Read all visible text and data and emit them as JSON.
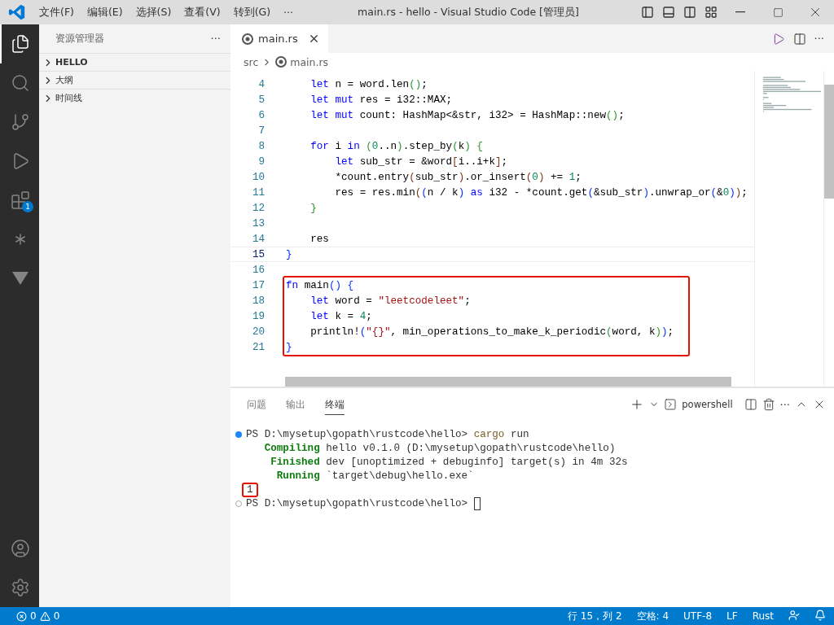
{
  "window": {
    "title": "main.rs - hello - Visual Studio Code [管理员]"
  },
  "menu": [
    "文件(F)",
    "编辑(E)",
    "选择(S)",
    "查看(V)",
    "转到(G)",
    "···"
  ],
  "activity_bar": {
    "items": [
      {
        "kind": "explorer",
        "selected": true
      },
      {
        "kind": "search",
        "selected": false
      },
      {
        "kind": "source-control",
        "selected": false
      },
      {
        "kind": "run",
        "selected": false
      },
      {
        "kind": "extensions",
        "selected": false,
        "badge": "1"
      },
      {
        "kind": "asterisk",
        "selected": false
      },
      {
        "kind": "triangle",
        "selected": false
      }
    ],
    "bottom": [
      {
        "kind": "account"
      },
      {
        "kind": "settings"
      }
    ]
  },
  "sidebar": {
    "title": "资源管理器",
    "more": "···",
    "sections": [
      {
        "label": "HELLO",
        "bold": true,
        "expanded": false
      },
      {
        "label": "大纲",
        "bold": false,
        "expanded": false
      },
      {
        "label": "时间线",
        "bold": false,
        "expanded": false
      }
    ]
  },
  "editor": {
    "tab": {
      "label": "main.rs",
      "more": "···"
    },
    "breadcrumbs": [
      "src",
      "main.rs"
    ],
    "lines": [
      {
        "number": "4",
        "tokens": [
          {
            "text": "    let",
            "kind": "kw"
          },
          {
            "text": " n = word.len",
            "kind": "plain"
          },
          {
            "text": "()",
            "kind": "b2"
          },
          {
            "text": ";",
            "kind": "plain"
          }
        ]
      },
      {
        "number": "5",
        "tokens": [
          {
            "text": "    let mut",
            "kind": "kw"
          },
          {
            "text": " res = i32::MAX;",
            "kind": "plain"
          }
        ]
      },
      {
        "number": "6",
        "tokens": [
          {
            "text": "    let mut",
            "kind": "kw"
          },
          {
            "text": " count: HashMap<&str, i32> = HashMap::new",
            "kind": "plain"
          },
          {
            "text": "()",
            "kind": "b2"
          },
          {
            "text": ";",
            "kind": "plain"
          }
        ]
      },
      {
        "number": "7"
      },
      {
        "number": "8",
        "tokens": [
          {
            "text": "    for",
            "kind": "kw"
          },
          {
            "text": " i ",
            "kind": "plain"
          },
          {
            "text": "in",
            "kind": "kw"
          },
          {
            "text": " (",
            "kind": "b2"
          },
          {
            "text": "0",
            "kind": "num"
          },
          {
            "text": "..n",
            "kind": "plain"
          },
          {
            "text": ")",
            "kind": "b2"
          },
          {
            "text": ".step_by",
            "kind": "plain"
          },
          {
            "text": "(",
            "kind": "b2"
          },
          {
            "text": "k",
            "kind": "plain"
          },
          {
            "text": ") {",
            "kind": "b2"
          }
        ]
      },
      {
        "number": "9",
        "tokens": [
          {
            "text": "        let",
            "kind": "kw"
          },
          {
            "text": " sub_str = &word",
            "kind": "plain"
          },
          {
            "text": "[",
            "kind": "b3"
          },
          {
            "text": "i..i+k",
            "kind": "plain"
          },
          {
            "text": "]",
            "kind": "b3"
          },
          {
            "text": ";",
            "kind": "plain"
          }
        ]
      },
      {
        "number": "10",
        "tokens": [
          {
            "text": "        *count.entry",
            "kind": "plain"
          },
          {
            "text": "(",
            "kind": "b3"
          },
          {
            "text": "sub_str",
            "kind": "plain"
          },
          {
            "text": ")",
            "kind": "b3"
          },
          {
            "text": ".or_insert",
            "kind": "plain"
          },
          {
            "text": "(",
            "kind": "b3"
          },
          {
            "text": "0",
            "kind": "num"
          },
          {
            "text": ")",
            "kind": "b3"
          },
          {
            "text": " += ",
            "kind": "plain"
          },
          {
            "text": "1",
            "kind": "num"
          },
          {
            "text": ";",
            "kind": "plain"
          }
        ]
      },
      {
        "number": "11",
        "tokens": [
          {
            "text": "        res = res.min",
            "kind": "plain"
          },
          {
            "text": "(",
            "kind": "b3"
          },
          {
            "text": "(",
            "kind": "b1"
          },
          {
            "text": "n / k",
            "kind": "plain"
          },
          {
            "text": ") ",
            "kind": "b1"
          },
          {
            "text": "as",
            "kind": "kw"
          },
          {
            "text": " i32 - *count.get",
            "kind": "plain"
          },
          {
            "text": "(",
            "kind": "b1"
          },
          {
            "text": "&sub_str",
            "kind": "plain"
          },
          {
            "text": ")",
            "kind": "b1"
          },
          {
            "text": ".unwrap_or",
            "kind": "plain"
          },
          {
            "text": "(",
            "kind": "b1"
          },
          {
            "text": "&",
            "kind": "plain"
          },
          {
            "text": "0",
            "kind": "num"
          },
          {
            "text": ")",
            "kind": "b1"
          },
          {
            "text": ")",
            "kind": "b3"
          },
          {
            "text": ";",
            "kind": "plain"
          }
        ]
      },
      {
        "number": "12",
        "tokens": [
          {
            "text": "    }",
            "kind": "b2"
          }
        ]
      },
      {
        "number": "13"
      },
      {
        "number": "14",
        "tokens": [
          {
            "text": "    res",
            "kind": "plain"
          }
        ]
      },
      {
        "number": "15",
        "current": true,
        "tokens": [
          {
            "text": "}",
            "kind": "b1"
          }
        ]
      },
      {
        "number": "16"
      },
      {
        "number": "17",
        "highlighted": true,
        "tokens": [
          {
            "text": "fn",
            "kind": "kw"
          },
          {
            "text": " main",
            "kind": "plain"
          },
          {
            "text": "() {",
            "kind": "b1"
          }
        ]
      },
      {
        "number": "18",
        "highlighted": true,
        "tokens": [
          {
            "text": "    let",
            "kind": "kw"
          },
          {
            "text": " word = ",
            "kind": "plain"
          },
          {
            "text": "\"leetcodeleet\"",
            "kind": "str"
          },
          {
            "text": ";",
            "kind": "plain"
          }
        ]
      },
      {
        "number": "19",
        "highlighted": true,
        "tokens": [
          {
            "text": "    let",
            "kind": "kw"
          },
          {
            "text": " k = ",
            "kind": "plain"
          },
          {
            "text": "4",
            "kind": "num"
          },
          {
            "text": ";",
            "kind": "plain"
          }
        ]
      },
      {
        "number": "20",
        "highlighted": true,
        "tokens": [
          {
            "text": "    println!",
            "kind": "plain"
          },
          {
            "text": "(",
            "kind": "b1"
          },
          {
            "text": "\"{}\"",
            "kind": "str"
          },
          {
            "text": ", min_operations_to_make_k_periodic",
            "kind": "plain"
          },
          {
            "text": "(",
            "kind": "b2"
          },
          {
            "text": "word, k",
            "kind": "plain"
          },
          {
            "text": ")",
            "kind": "b2"
          },
          {
            "text": ")",
            "kind": "b1"
          },
          {
            "text": ";",
            "kind": "plain"
          }
        ]
      },
      {
        "number": "21",
        "highlighted": true,
        "tokens": [
          {
            "text": "}",
            "kind": "b1"
          }
        ]
      }
    ]
  },
  "panel": {
    "tabs": [
      {
        "label": "问题",
        "selected": false
      },
      {
        "label": "输出",
        "selected": false
      },
      {
        "label": "终端",
        "selected": true
      }
    ],
    "shell": "powershell",
    "more": "···",
    "terminal": [
      {
        "command": true,
        "succeeded": true,
        "tokens": [
          {
            "text": "PS D:\\mysetup\\gopath\\rustcode\\hello> ",
            "kind": "plain"
          },
          {
            "text": "cargo",
            "kind": "cmd"
          },
          {
            "text": " run",
            "kind": "plain"
          }
        ]
      },
      {
        "tokens": [
          {
            "text": "   Compiling",
            "kind": "status"
          },
          {
            "text": " hello v0.1.0 (D:\\mysetup\\gopath\\rustcode\\hello)",
            "kind": "plain"
          }
        ]
      },
      {
        "tokens": [
          {
            "text": "    Finished",
            "kind": "status"
          },
          {
            "text": " dev [unoptimized + debuginfo] target(s) in 4m 32s",
            "kind": "plain"
          }
        ]
      },
      {
        "tokens": [
          {
            "text": "     Running",
            "kind": "status"
          },
          {
            "text": " `target\\debug\\hello.exe`",
            "kind": "plain"
          }
        ]
      },
      {
        "highlighted": true,
        "tokens": [
          {
            "text": "1",
            "kind": "plain"
          }
        ]
      },
      {
        "command": true,
        "succeeded": false,
        "cursor": true,
        "tokens": [
          {
            "text": "PS D:\\mysetup\\gopath\\rustcode\\hello> ",
            "kind": "plain"
          }
        ]
      }
    ]
  },
  "status_bar": {
    "errors": "0",
    "warnings": "0",
    "right": [
      "行 15，列 2",
      "空格: 4",
      "UTF-8",
      "LF",
      "Rust"
    ]
  }
}
